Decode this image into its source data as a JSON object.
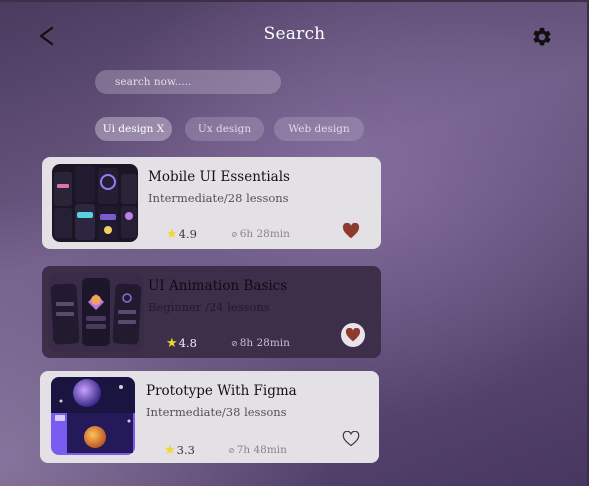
{
  "header": {
    "title": "Search",
    "back_icon": "chevron-left-icon",
    "settings_icon": "gear-icon"
  },
  "search": {
    "placeholder": "search now.....",
    "value": ""
  },
  "filters": [
    {
      "label": "Ui design X",
      "active": true
    },
    {
      "label": "Ux design",
      "active": false
    },
    {
      "label": "Web design",
      "active": false
    }
  ],
  "courses": [
    {
      "title": "Mobile UI Essentials",
      "subtitle": "Intermediate/28 lessons",
      "rating": "4.9",
      "duration": "6h 28min",
      "favorite": true,
      "icon": "heart-icon"
    },
    {
      "title": "UI Animation Basics",
      "subtitle": "Beginner /24 lessons",
      "rating": "4.8",
      "duration": "8h 28min",
      "favorite": true,
      "icon": "heart-icon"
    },
    {
      "title": "Prototype With Figma",
      "subtitle": "Intermediate/38 lessons",
      "rating": "3.3",
      "duration": "7h 48min",
      "favorite": false,
      "icon": "heart-outline-icon"
    }
  ],
  "colors": {
    "favorite": "#8e3a2c",
    "star": "#f0d72a"
  }
}
